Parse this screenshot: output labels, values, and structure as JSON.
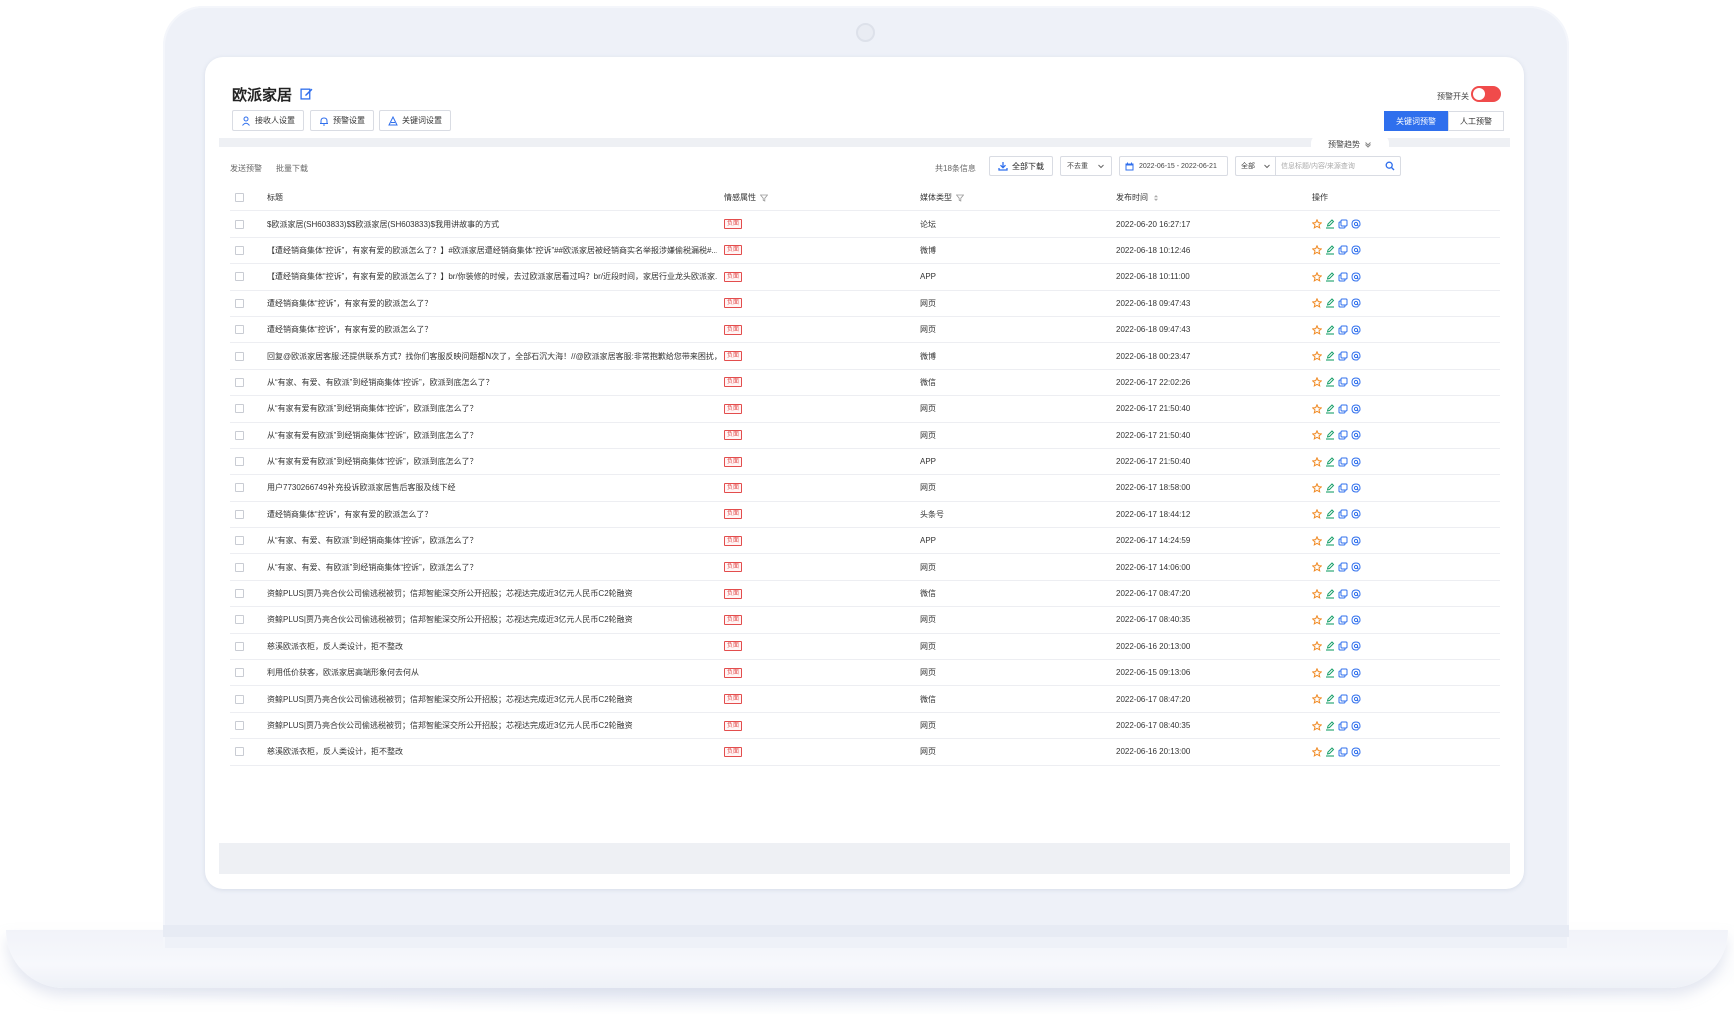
{
  "app": {
    "title": "欧派家居"
  },
  "toolbar": {
    "recipients_label": "接收人设置",
    "alert_settings_label": "预警设置",
    "keyword_settings_label": "关键词设置"
  },
  "alert": {
    "switch_label": "预警开关",
    "switch_on": true,
    "keyword_alert_label": "关键词预警",
    "manual_alert_label": "人工预警",
    "trend_label": "预警趋势"
  },
  "list_toolbar": {
    "send_alert_label": "发送预警",
    "batch_download_label": "批量下载",
    "total_info": "共18条信息",
    "download_all_label": "全部下载",
    "dedupe_value": "不去重",
    "date_range": "2022-06-15 - 2022-06-21",
    "scope_value": "全部",
    "search_placeholder": "信息标题/内容/来源查询"
  },
  "table": {
    "headers": {
      "title": "标题",
      "sentiment": "情感属性",
      "media": "媒体类型",
      "time": "发布时间",
      "ops": "操作"
    },
    "rows": [
      {
        "title": "$欧派家居(SH603833)$$欧派家居(SH603833)$我用讲故事的方式",
        "sentiment": "负面",
        "media": "论坛",
        "time": "2022-06-20 16:27:17"
      },
      {
        "title": "【遭经销商集体“控诉”，有家有爱的欧派怎么了？】#欧派家居遭经销商集体“控诉”##欧派家居被经销商实名举报涉嫌偷税漏税#...",
        "sentiment": "负面",
        "media": "微博",
        "time": "2022-06-18 10:12:46"
      },
      {
        "title": "【遭经销商集体“控诉”，有家有爱的欧派怎么了？】br/你装修的时候，去过欧派家居看过吗？br/近段时间，家居行业龙头欧派家...",
        "sentiment": "负面",
        "media": "APP",
        "time": "2022-06-18 10:11:00"
      },
      {
        "title": "遭经销商集体“控诉”，有家有爱的欧派怎么了？",
        "sentiment": "负面",
        "media": "网页",
        "time": "2022-06-18 09:47:43"
      },
      {
        "title": "遭经销商集体“控诉”，有家有爱的欧派怎么了？",
        "sentiment": "负面",
        "media": "网页",
        "time": "2022-06-18 09:47:43"
      },
      {
        "title": "回复@欧派家居客服:还提供联系方式？找你们客服反映问题都N次了，全部石沉大海！//@欧派家居客服:非常抱歉给您带来困扰，...",
        "sentiment": "负面",
        "media": "微博",
        "time": "2022-06-18 00:23:47"
      },
      {
        "title": "从“有家、有爱、有欧派”到经销商集体“控诉”，欧派到底怎么了？",
        "sentiment": "负面",
        "media": "微信",
        "time": "2022-06-17 22:02:26"
      },
      {
        "title": "从“有家有爱有欧派”到经销商集体“控诉”，欧派到底怎么了？",
        "sentiment": "负面",
        "media": "网页",
        "time": "2022-06-17 21:50:40"
      },
      {
        "title": "从“有家有爱有欧派”到经销商集体“控诉”，欧派到底怎么了？",
        "sentiment": "负面",
        "media": "网页",
        "time": "2022-06-17 21:50:40"
      },
      {
        "title": "从“有家有爱有欧派”到经销商集体“控诉”，欧派到底怎么了？",
        "sentiment": "负面",
        "media": "APP",
        "time": "2022-06-17 21:50:40"
      },
      {
        "title": "用户7730266749补充投诉欧派家居售后客服及线下经",
        "sentiment": "负面",
        "media": "网页",
        "time": "2022-06-17 18:58:00"
      },
      {
        "title": "遭经销商集体“控诉”，有家有爱的欧派怎么了？",
        "sentiment": "负面",
        "media": "头条号",
        "time": "2022-06-17 18:44:12"
      },
      {
        "title": "从“有家、有爱、有欧派”到经销商集体“控诉”，欧派怎么了？",
        "sentiment": "负面",
        "media": "APP",
        "time": "2022-06-17 14:24:59"
      },
      {
        "title": "从“有家、有爱、有欧派”到经销商集体“控诉”，欧派怎么了？",
        "sentiment": "负面",
        "media": "网页",
        "time": "2022-06-17 14:06:00"
      },
      {
        "title": "资鲸PLUS|贾乃亮合伙公司偷逃税被罚；信邦智能深交所公开招股；芯视达完成近3亿元人民币C2轮融资",
        "sentiment": "负面",
        "media": "微信",
        "time": "2022-06-17 08:47:20"
      },
      {
        "title": "资鲸PLUS|贾乃亮合伙公司偷逃税被罚；信邦智能深交所公开招股；芯视达完成近3亿元人民币C2轮融资",
        "sentiment": "负面",
        "media": "网页",
        "time": "2022-06-17 08:40:35"
      },
      {
        "title": "慈溪欧派衣柜，反人类设计，拒不整改",
        "sentiment": "负面",
        "media": "网页",
        "time": "2022-06-16 20:13:00"
      },
      {
        "title": "利用低价获客，欧派家居高端形象何去何从",
        "sentiment": "负面",
        "media": "网页",
        "time": "2022-06-15 09:13:06"
      },
      {
        "title": "资鲸PLUS|贾乃亮合伙公司偷逃税被罚；信邦智能深交所公开招股；芯视达完成近3亿元人民币C2轮融资",
        "sentiment": "负面",
        "media": "微信",
        "time": "2022-06-17 08:47:20"
      },
      {
        "title": "资鲸PLUS|贾乃亮合伙公司偷逃税被罚；信邦智能深交所公开招股；芯视达完成近3亿元人民币C2轮融资",
        "sentiment": "负面",
        "media": "网页",
        "time": "2022-06-17 08:40:35"
      },
      {
        "title": "慈溪欧派衣柜，反人类设计，拒不整改",
        "sentiment": "负面",
        "media": "网页",
        "time": "2022-06-16 20:13:00"
      }
    ]
  },
  "icons": {
    "edit": "edit-icon",
    "user": "user-icon",
    "bell": "bell-icon",
    "keyword": "triangle-icon",
    "download": "download-icon",
    "calendar": "calendar-icon",
    "search": "search-icon",
    "row_ops": [
      "star-icon",
      "edit-report-icon",
      "copy-icon",
      "at-icon"
    ]
  },
  "colors": {
    "primary": "#2f6fed",
    "negative": "#e34d4d",
    "toggle_on": "#f04b4b",
    "op_star": "#f08a24",
    "op_edit": "#1aa06a",
    "op_copy": "#2f6fed",
    "op_at": "#2f6fed"
  }
}
